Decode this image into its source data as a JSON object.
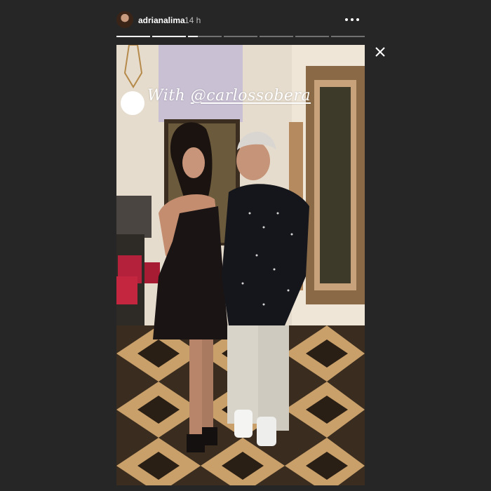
{
  "story": {
    "username": "adrianalima",
    "time": "14 h",
    "segments": [
      1,
      1,
      0.3,
      0,
      0,
      0,
      0
    ],
    "caption_prefix": "With ",
    "caption_mention": "@carlossobera"
  },
  "icons": {
    "more": "more-options-icon",
    "close": "close-icon"
  }
}
